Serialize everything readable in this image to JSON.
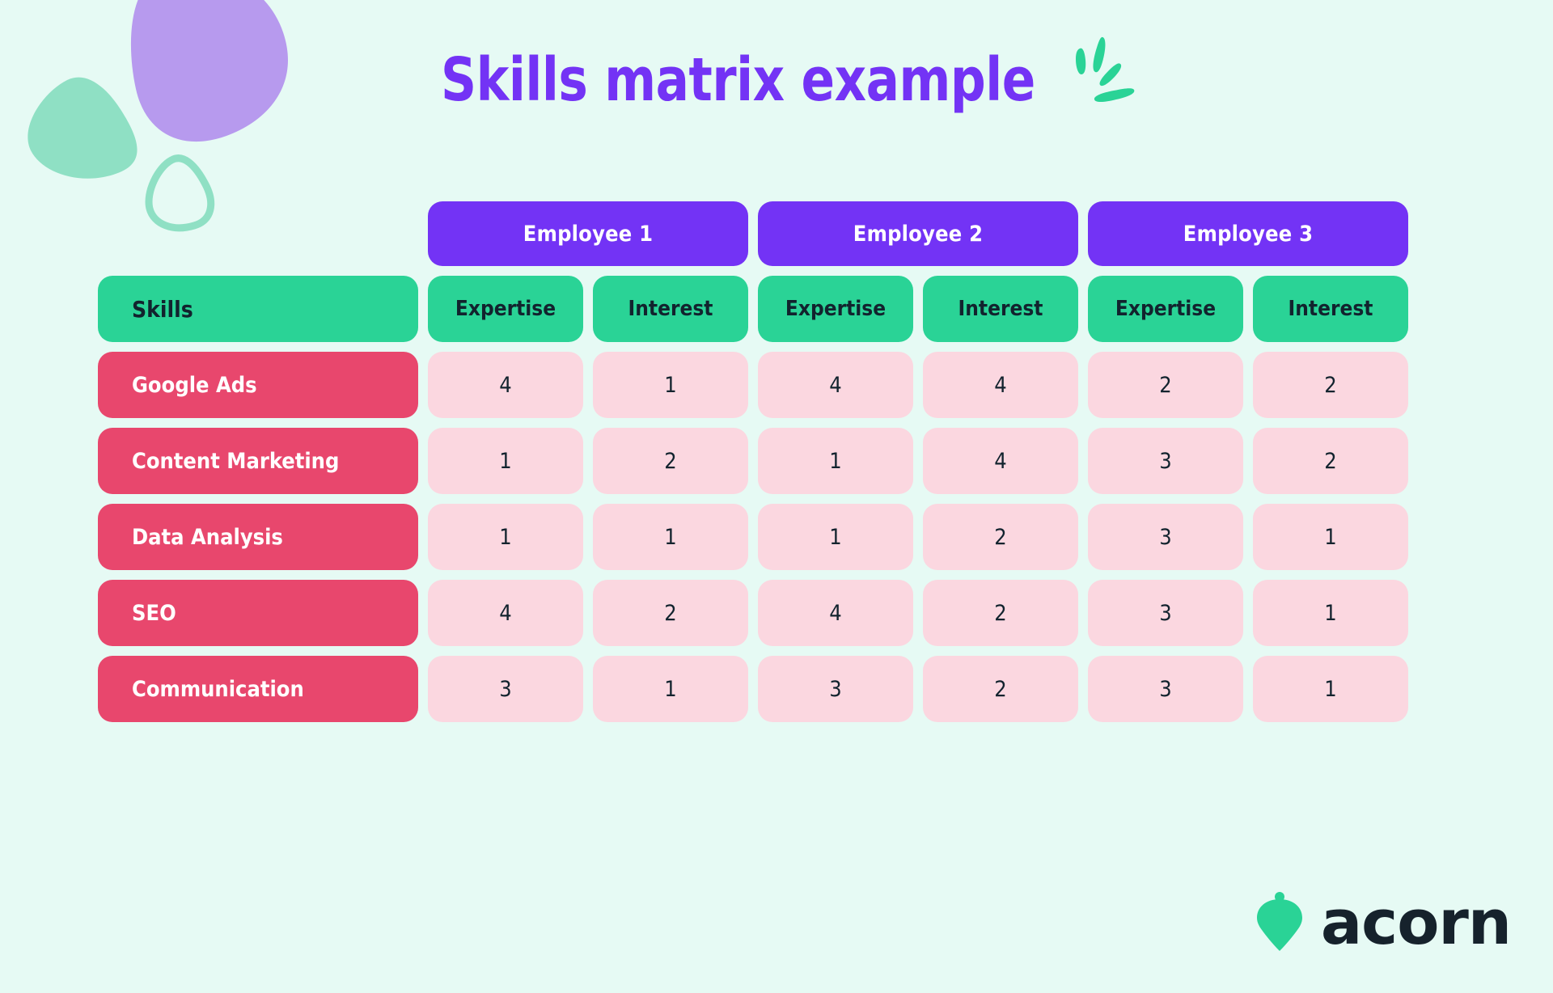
{
  "title": "Skills matrix example",
  "brand": {
    "name": "acorn",
    "logo_icon": "acorn-icon"
  },
  "colors": {
    "background": "#e6faf4",
    "purple": "#7333f5",
    "green": "#2ad396",
    "crimson": "#e8476d",
    "pale_pink": "#fbd7e0",
    "text_dark": "#12232e",
    "lavender_blob": "#b79aee",
    "mint_blob": "#8fe0c4"
  },
  "decorations": {
    "sparkle_icon": "sparkle-icon",
    "blob_large_icon": "lavender-blob-icon",
    "blob_filled_icon": "mint-blob-icon",
    "blob_outline_icon": "mint-outline-blob-icon"
  },
  "table": {
    "employees": [
      "Employee 1",
      "Employee 2",
      "Employee 3"
    ],
    "skills_header": "Skills",
    "sub_headers": [
      "Expertise",
      "Interest"
    ],
    "rows": [
      {
        "skill": "Google Ads",
        "values": [
          "4",
          "1",
          "4",
          "4",
          "2",
          "2"
        ]
      },
      {
        "skill": "Content Marketing",
        "values": [
          "1",
          "2",
          "1",
          "4",
          "3",
          "2"
        ]
      },
      {
        "skill": "Data Analysis",
        "values": [
          "1",
          "1",
          "1",
          "2",
          "3",
          "1"
        ]
      },
      {
        "skill": "SEO",
        "values": [
          "4",
          "2",
          "4",
          "2",
          "3",
          "1"
        ]
      },
      {
        "skill": "Communication",
        "values": [
          "3",
          "1",
          "3",
          "2",
          "3",
          "1"
        ]
      }
    ]
  },
  "chart_data": {
    "type": "table",
    "title": "Skills matrix example",
    "groups": [
      "Employee 1",
      "Employee 2",
      "Employee 3"
    ],
    "measures": [
      "Expertise",
      "Interest"
    ],
    "categories": [
      "Google Ads",
      "Content Marketing",
      "Data Analysis",
      "SEO",
      "Communication"
    ],
    "columns": [
      "Skills",
      "Employee 1 Expertise",
      "Employee 1 Interest",
      "Employee 2 Expertise",
      "Employee 2 Interest",
      "Employee 3 Expertise",
      "Employee 3 Interest"
    ],
    "series": [
      {
        "name": "Employee 1 Expertise",
        "values": [
          4,
          1,
          1,
          4,
          3
        ]
      },
      {
        "name": "Employee 1 Interest",
        "values": [
          1,
          2,
          1,
          2,
          1
        ]
      },
      {
        "name": "Employee 2 Expertise",
        "values": [
          4,
          1,
          1,
          4,
          3
        ]
      },
      {
        "name": "Employee 2 Interest",
        "values": [
          4,
          4,
          2,
          2,
          2
        ]
      },
      {
        "name": "Employee 3 Expertise",
        "values": [
          2,
          3,
          3,
          3,
          3
        ]
      },
      {
        "name": "Employee 3 Interest",
        "values": [
          2,
          2,
          1,
          1,
          1
        ]
      }
    ],
    "value_range": [
      1,
      4
    ]
  }
}
